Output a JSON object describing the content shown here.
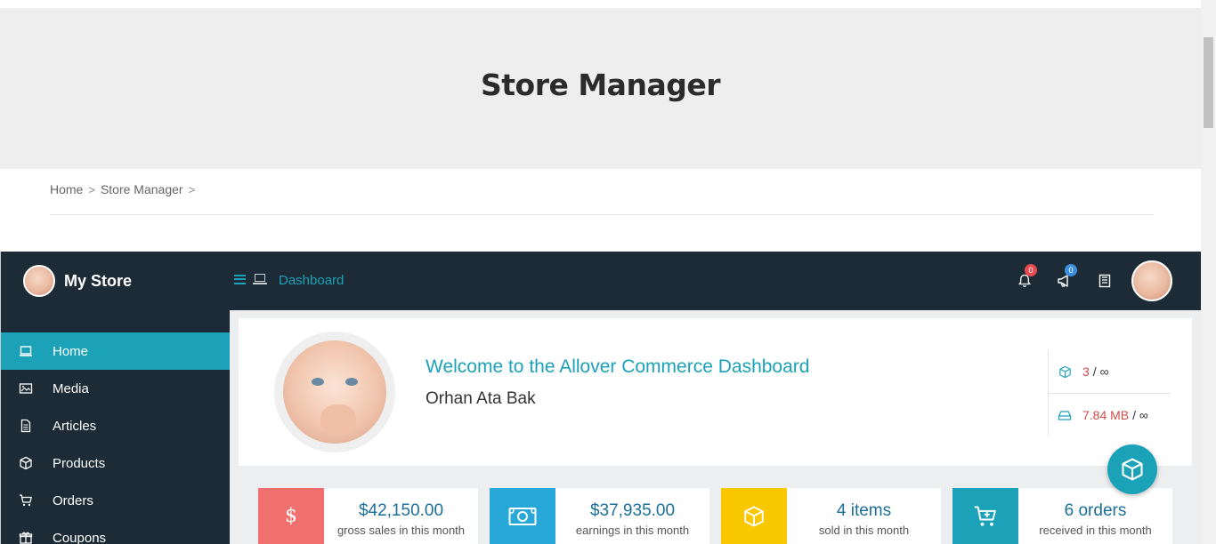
{
  "hero": {
    "title": "Store Manager"
  },
  "breadcrumb": {
    "items": [
      "Home",
      "Store Manager"
    ]
  },
  "topbar": {
    "store_name": "My Store",
    "dashboard_label": "Dashboard",
    "notifications_count": "0",
    "announcements_count": "0",
    "icons": [
      "menu-icon",
      "laptop-icon",
      "bell-icon",
      "megaphone-icon",
      "book-icon"
    ]
  },
  "sidebar": {
    "items": [
      {
        "label": "Home",
        "icon": "laptop-icon",
        "active": true
      },
      {
        "label": "Media",
        "icon": "image-icon"
      },
      {
        "label": "Articles",
        "icon": "document-icon"
      },
      {
        "label": "Products",
        "icon": "cube-icon"
      },
      {
        "label": "Orders",
        "icon": "cart-icon"
      },
      {
        "label": "Coupons",
        "icon": "gift-icon"
      }
    ]
  },
  "welcome": {
    "title": "Welcome to the Allover Commerce Dashboard",
    "user_name": "Orhan Ata Bak",
    "product_limit": {
      "value": "3",
      "max": "/ ∞"
    },
    "space_limit": {
      "value": "7.84 MB",
      "max": "/ ∞"
    }
  },
  "stats": [
    {
      "value": "$42,150.00",
      "label": "gross sales in this month",
      "color": "#f0706f",
      "icon": "dollar-icon"
    },
    {
      "value": "$37,935.00",
      "label": "earnings in this month",
      "color": "#27a8d9",
      "icon": "money-icon"
    },
    {
      "value": "4 items",
      "label": "sold in this month",
      "color": "#f9c800",
      "icon": "cube-icon"
    },
    {
      "value": "6 orders",
      "label": "received in this month",
      "color": "#1ba2b8",
      "icon": "cart-plus-icon"
    }
  ],
  "colors": {
    "accent": "#1ba2b8",
    "nav_bg": "#1c2b36",
    "limit_value": "#d04b4b"
  }
}
